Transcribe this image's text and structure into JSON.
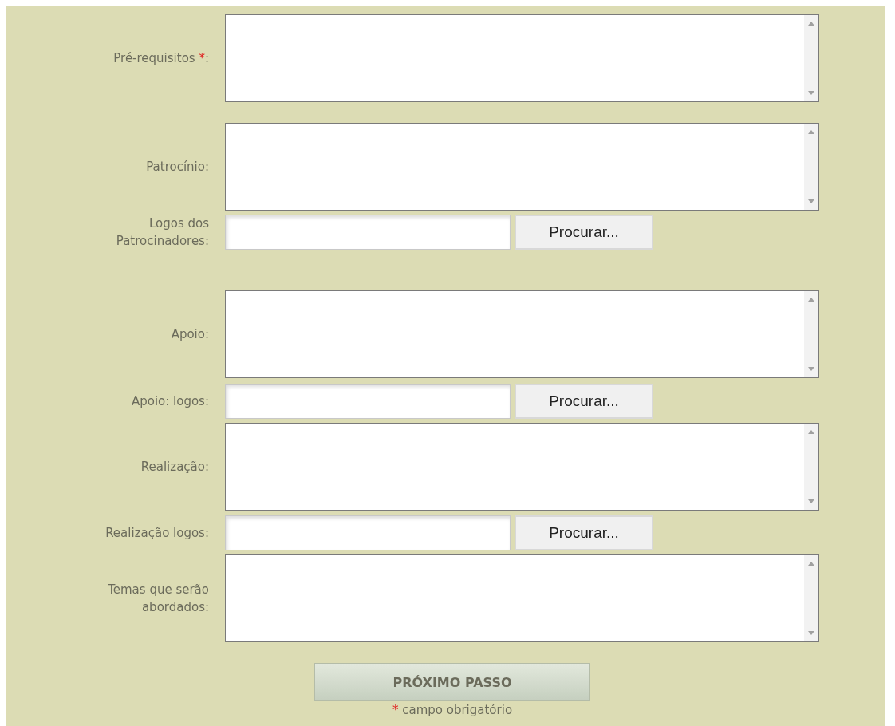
{
  "form": {
    "fields": [
      {
        "kind": "textarea",
        "label": "Pré-requisitos",
        "required_mark": "*",
        "label_end": ":"
      },
      {
        "kind": "textarea",
        "label": "Patrocínio:"
      },
      {
        "kind": "file",
        "label": "Logos dos Patrocinadores:",
        "button": "Procurar..."
      },
      {
        "kind": "textarea",
        "label": "Apoio:"
      },
      {
        "kind": "file",
        "label": "Apoio: logos:",
        "button": "Procurar..."
      },
      {
        "kind": "textarea",
        "label": "Realização:"
      },
      {
        "kind": "file",
        "label": "Realização logos:",
        "button": "Procurar..."
      },
      {
        "kind": "textarea",
        "label": "Temas que serão abordados:"
      }
    ],
    "submit": "PRÓXIMO PASSO",
    "footnote": {
      "mark": "*",
      "text": "campo obrigatório"
    }
  }
}
